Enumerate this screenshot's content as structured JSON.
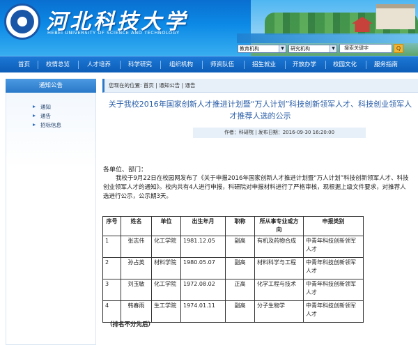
{
  "header": {
    "school_name_cn": "河北科技大学",
    "school_name_en": "HEBEI UNIVERSITY OF SCIENCE AND TECHNOLOGY",
    "dept_select_value": "教育机构",
    "inst_select_value": "研究机构",
    "search_placeholder": "搜索关键字",
    "search_button_label": "Q",
    "logo_icon": "university-seal-icon",
    "colors": {
      "banner": "#0c8ae6",
      "nav": "#0c5db8",
      "title_blue": "#2a5ea8"
    }
  },
  "nav": {
    "items": [
      "首页",
      "校情总览",
      "人才培养",
      "科学研究",
      "组织机构",
      "师资队伍",
      "招生就业",
      "开放办学",
      "校园文化",
      "服务指南"
    ]
  },
  "sidebar": {
    "title": "通知公告",
    "items": [
      "通知",
      "通告",
      "招标信息"
    ]
  },
  "breadcrumb": {
    "prefix": "您现在的位置:",
    "home": "首页",
    "sep1": "|",
    "category": "通知公告",
    "sep2": "|",
    "current": "通告"
  },
  "article": {
    "title": "关于我校2016年国家创新人才推进计划暨“万人计划”科技创新领军人才、科技创业领军人才推荐人选的公示",
    "meta": "作者：科研院 | 发布日期：2016-09-30 16:20:00",
    "salutation": "各单位、部门：",
    "body": "我校于9月22日在校园网发布了《关于申报2016年国家创新人才推进计划暨“万人计划”科技创新领军人才、科技创业领军人才的通知》。校内共有4人进行申报，科研院对申报材料进行了严格审核，现根据上级文件要求，对推荐人选进行公示，公示期3天。",
    "table": {
      "headers": [
        "序号",
        "姓名",
        "单位",
        "出生年月",
        "职称",
        "所从事专业或方向",
        "申报类别"
      ],
      "rows": [
        [
          "1",
          "张志伟",
          "化工学院",
          "1981.12.05",
          "副高",
          "有机及药物合成",
          "中青年科技创新领军人才"
        ],
        [
          "2",
          "孙占英",
          "材料学院",
          "1980.05.07",
          "副高",
          "材料科学与工程",
          "中青年科技创新领军人才"
        ],
        [
          "3",
          "刘玉敏",
          "化工学院",
          "1972.08.02",
          "正高",
          "化学工程与技术",
          "中青年科技创新领军人才"
        ],
        [
          "4",
          "韩春雨",
          "生工学院",
          "1974.01.11",
          "副高",
          "分子生物学",
          "中青年科技创新领军人才"
        ]
      ]
    },
    "note": "（排名不分先后）"
  }
}
